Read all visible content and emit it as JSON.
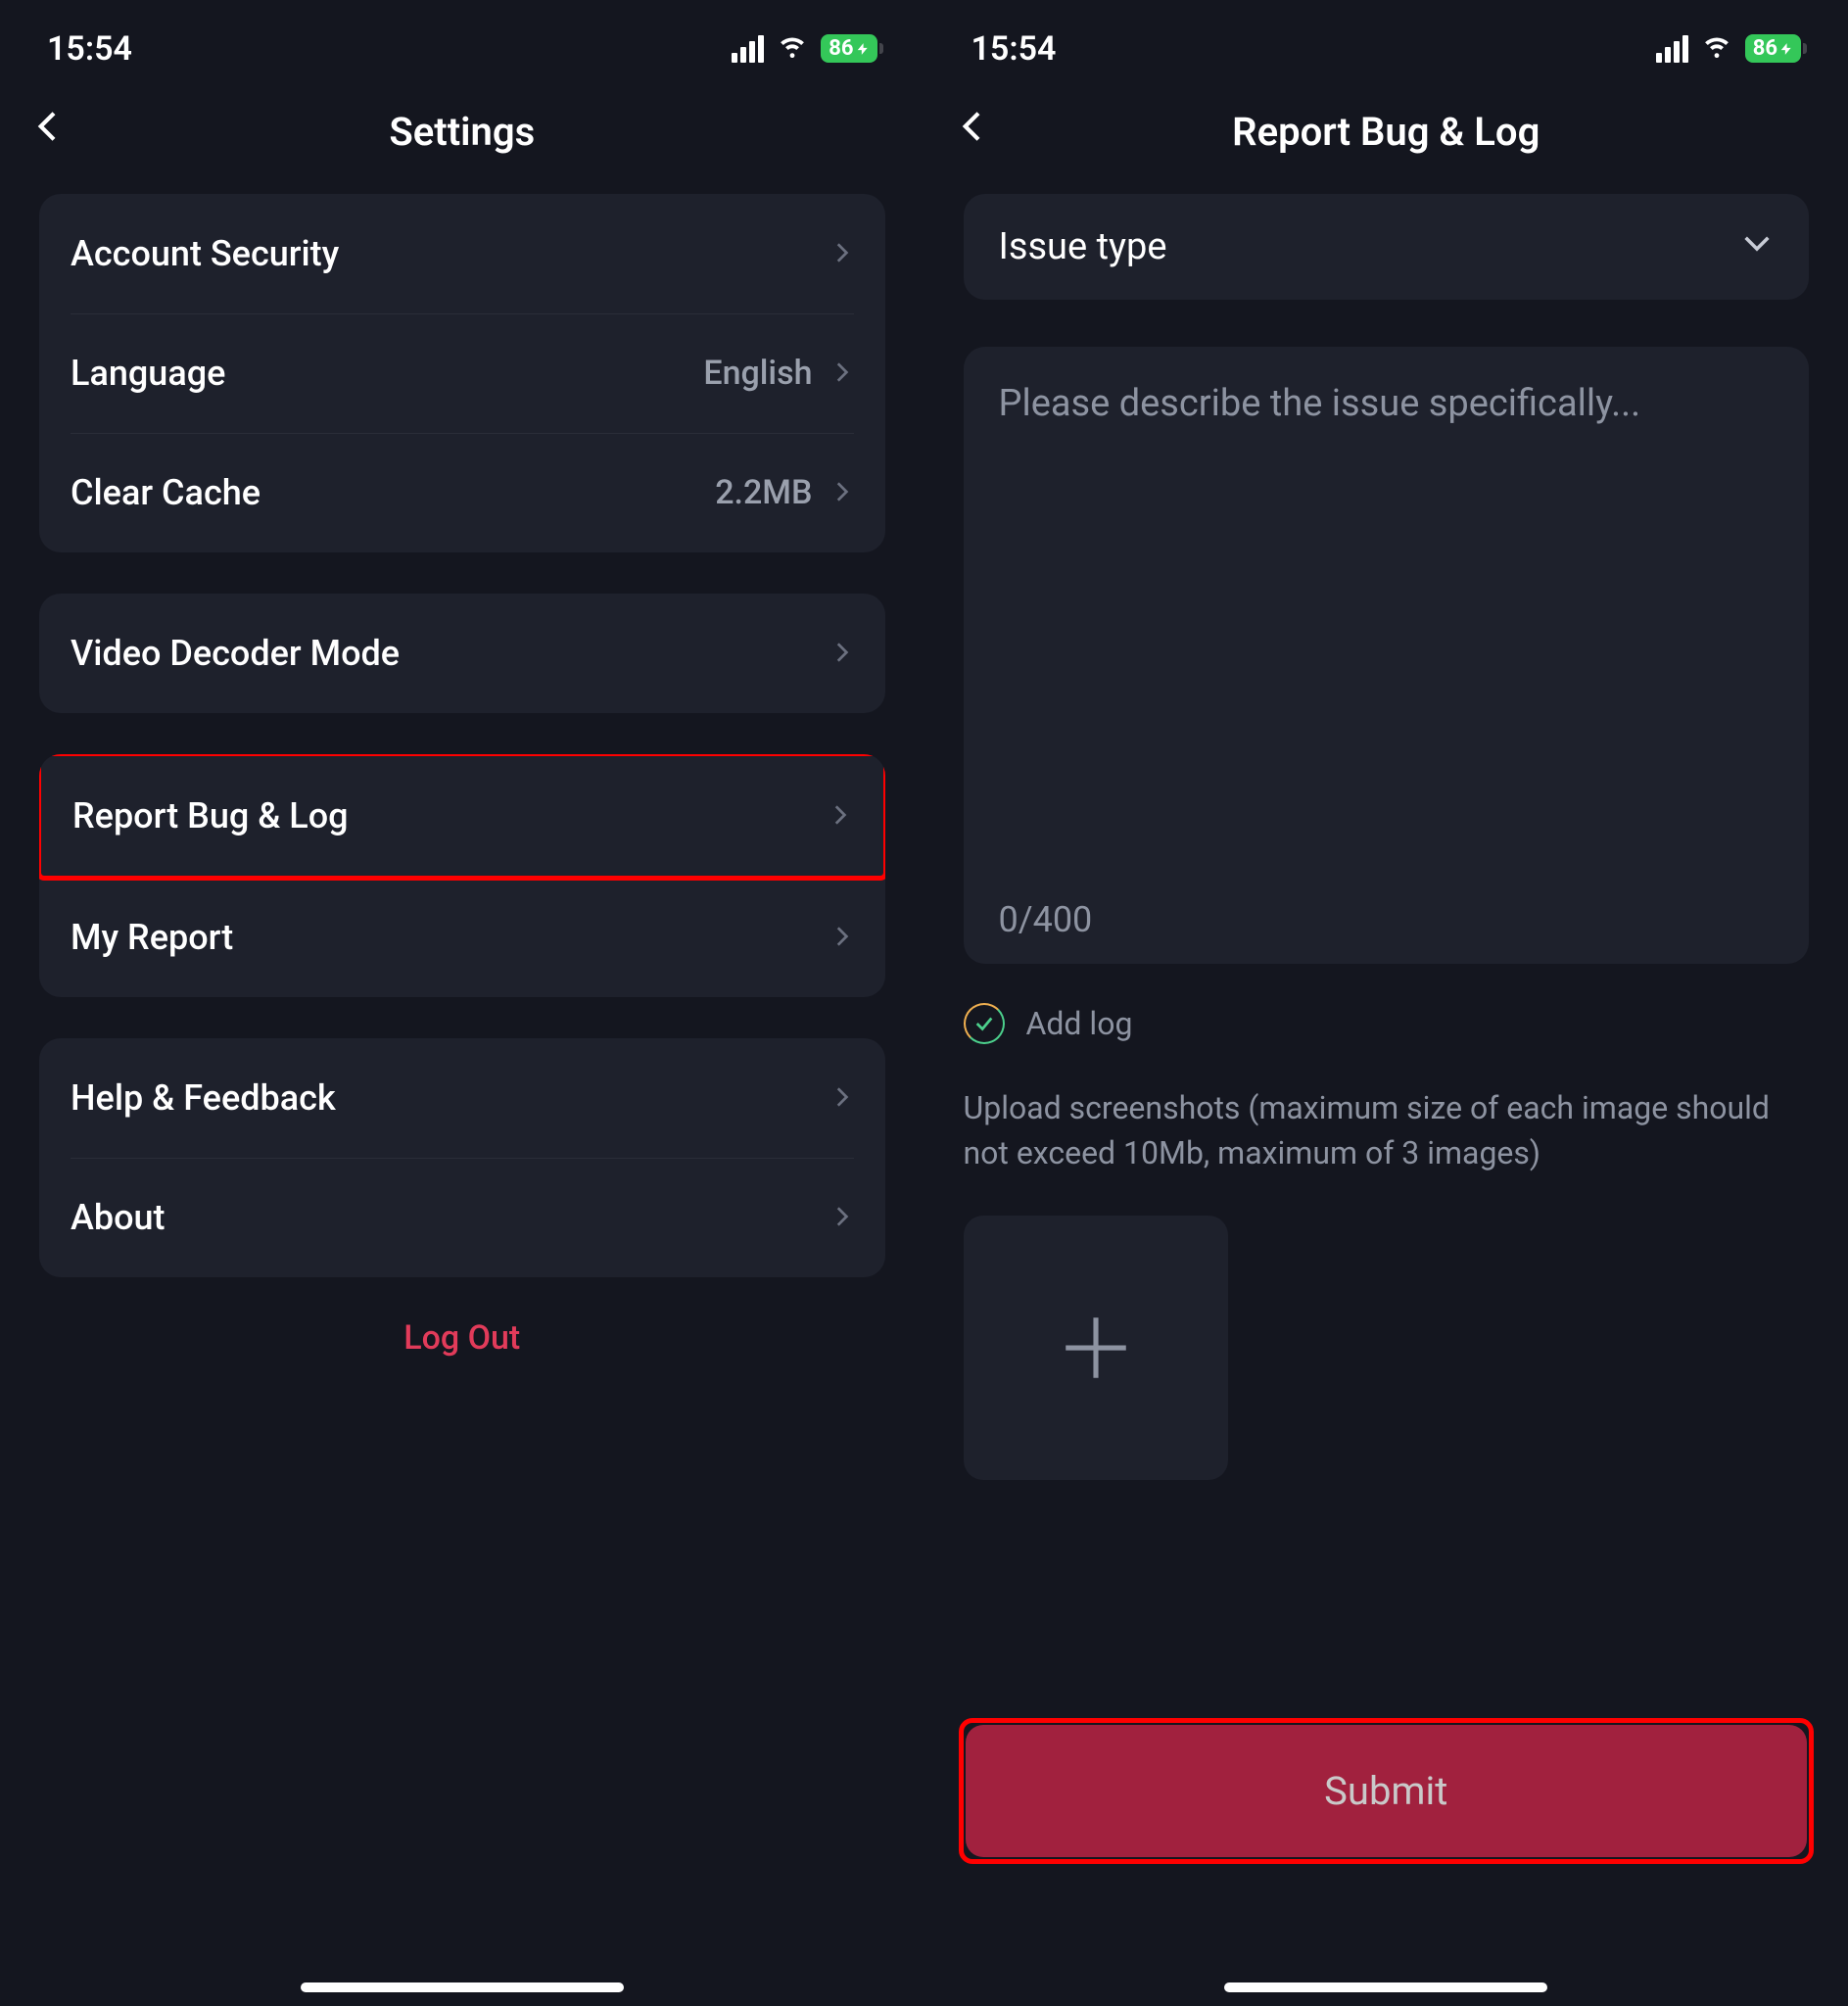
{
  "status": {
    "time": "15:54",
    "battery": "86"
  },
  "left": {
    "title": "Settings",
    "groups": [
      [
        {
          "label": "Account Security",
          "value": ""
        },
        {
          "label": "Language",
          "value": "English"
        },
        {
          "label": "Clear Cache",
          "value": "2.2MB"
        }
      ],
      [
        {
          "label": "Video Decoder Mode",
          "value": ""
        }
      ],
      [
        {
          "label": "Report Bug & Log",
          "value": "",
          "highlighted": true
        },
        {
          "label": "My Report",
          "value": ""
        }
      ],
      [
        {
          "label": "Help & Feedback",
          "value": ""
        },
        {
          "label": "About",
          "value": ""
        }
      ]
    ],
    "logout": "Log Out"
  },
  "right": {
    "title": "Report Bug & Log",
    "issue_type_label": "Issue type",
    "desc_placeholder": "Please describe the issue specifically...",
    "counter": "0/400",
    "add_log": "Add log",
    "upload_hint": "Upload screenshots (maximum size of each image should not exceed 10Mb, maximum of 3 images)",
    "submit": "Submit"
  }
}
